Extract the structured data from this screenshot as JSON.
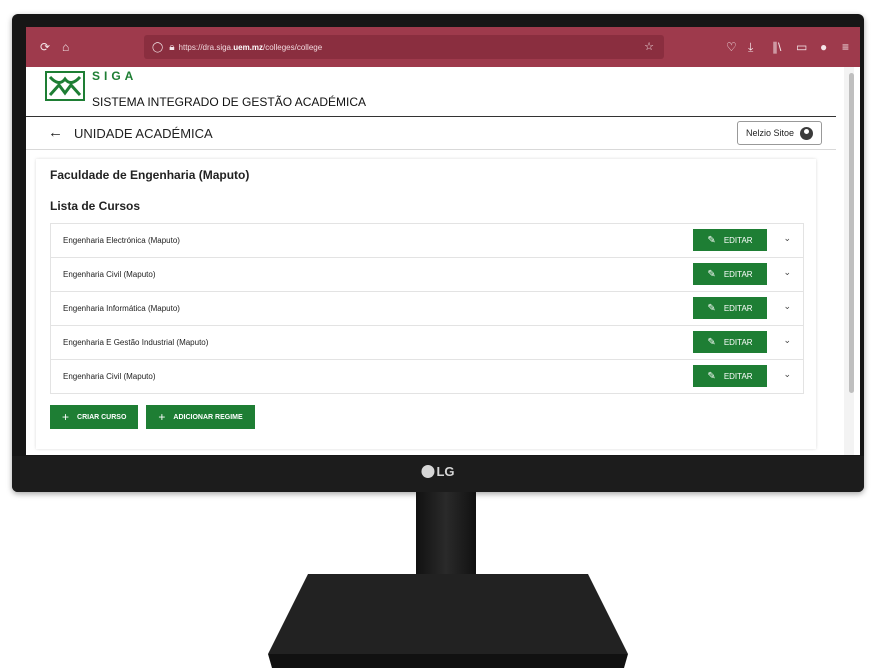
{
  "browser": {
    "url_prefix": "https://dra.siga.",
    "url_domain": "uem.mz",
    "url_path": "/colleges/college",
    "icons": [
      "reload-icon",
      "home-icon",
      "shield-icon",
      "lock-icon",
      "star-icon",
      "pocket-icon",
      "download-icon",
      "library-icon",
      "sidebar-icon",
      "account-icon",
      "menu-icon"
    ]
  },
  "brand": {
    "name": "SIGA",
    "subtitle": "SISTEMA INTEGRADO DE GESTÃO ACADÉMICA",
    "color": "#1e7e34"
  },
  "appbar": {
    "title": "UNIDADE ACADÉMICA",
    "user": "Nelzio Sitoe"
  },
  "content": {
    "faculty": "Faculdade de Engenharia (Maputo)",
    "list_title": "Lista de Cursos",
    "edit_label": "EDITAR",
    "courses": [
      "Engenharia Electrónica (Maputo)",
      "Engenharia Civil (Maputo)",
      "Engenharia Informática (Maputo)",
      "Engenharia E Gestão Industrial (Maputo)",
      "Engenharia Civil (Maputo)"
    ],
    "create_course": "CRIAR CURSO",
    "add_regime": "ADICIONAR REGIME"
  },
  "monitor": {
    "brand": "LG"
  }
}
